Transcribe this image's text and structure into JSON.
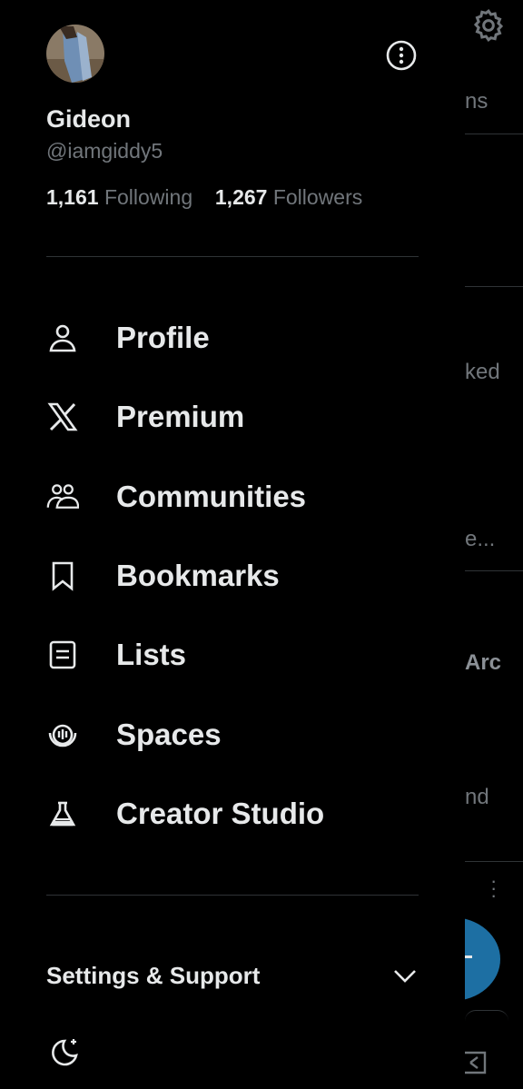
{
  "background": {
    "fragments": [
      "ns",
      "ked",
      "e...",
      "Arc",
      "nd"
    ]
  },
  "profile": {
    "name": "Gideon",
    "handle": "@iamgiddy5",
    "following_count": "1,161",
    "following_label": "Following",
    "followers_count": "1,267",
    "followers_label": "Followers"
  },
  "menu": {
    "items": [
      {
        "label": "Profile",
        "icon": "person-icon"
      },
      {
        "label": "Premium",
        "icon": "x-logo-icon"
      },
      {
        "label": "Communities",
        "icon": "communities-icon"
      },
      {
        "label": "Bookmarks",
        "icon": "bookmark-icon"
      },
      {
        "label": "Lists",
        "icon": "list-icon"
      },
      {
        "label": "Spaces",
        "icon": "spaces-icon"
      },
      {
        "label": "Creator Studio",
        "icon": "flask-icon"
      }
    ]
  },
  "settings": {
    "label": "Settings & Support"
  },
  "colors": {
    "background": "#000000",
    "text": "#e7e9ea",
    "muted": "#71767b",
    "divider": "#2f3336",
    "accent": "#1d9bf0"
  }
}
